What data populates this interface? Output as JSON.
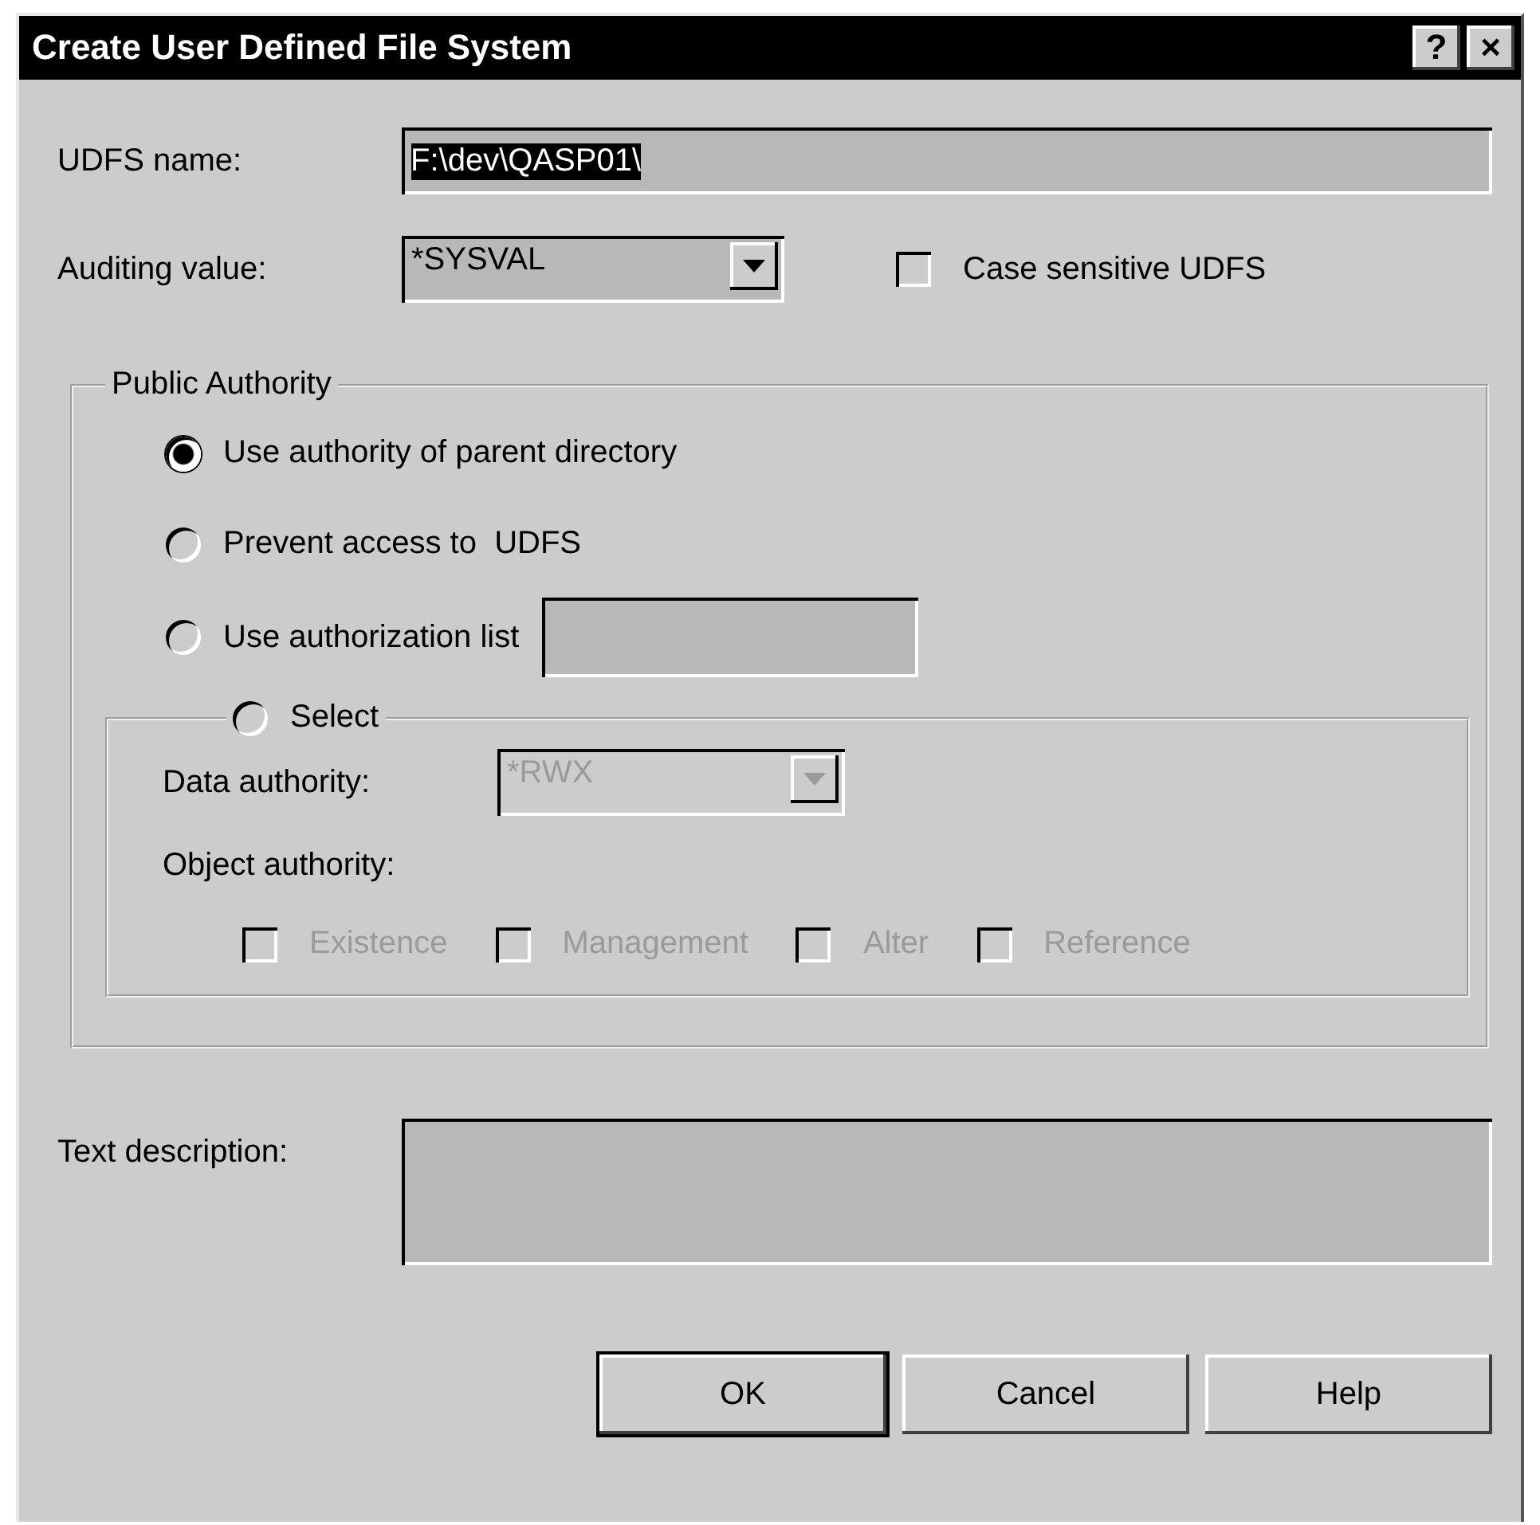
{
  "window": {
    "title": "Create User Defined File System",
    "title_buttons": [
      "?",
      "×"
    ]
  },
  "udfs_name": {
    "label": "UDFS name:",
    "value": "F:\\dev\\QASP01\\",
    "value_selected": true
  },
  "auditing": {
    "label": "Auditing value:",
    "value": "*SYSVAL",
    "disabled": false
  },
  "case_sensitive": {
    "label": "Case sensitive UDFS",
    "checked": false,
    "disabled": false
  },
  "public_authority": {
    "title": "Public Authority",
    "options": [
      {
        "label": "Use authority of parent directory",
        "selected": true,
        "kind": "plain"
      },
      {
        "label": "Prevent access to  UDFS",
        "selected": false,
        "kind": "plain"
      },
      {
        "label": "Use authorization list",
        "selected": false,
        "kind": "field"
      },
      {
        "label": "Select",
        "selected": false,
        "kind": "group"
      }
    ]
  },
  "select_group": {
    "data_authority": {
      "label": "Data authority:",
      "value": "*RWX",
      "disabled": true
    },
    "object_authority": {
      "label": "Object authority:",
      "options": [
        {
          "label": "Existence",
          "checked": false,
          "disabled": true
        },
        {
          "label": "Management",
          "checked": false,
          "disabled": true
        },
        {
          "label": "Alter",
          "checked": false,
          "disabled": true
        },
        {
          "label": "Reference",
          "checked": false,
          "disabled": true
        }
      ]
    }
  },
  "text_description": {
    "label": "Text description:"
  },
  "buttons": [
    {
      "label": "OK",
      "default": true
    },
    {
      "label": "Cancel",
      "default": false
    },
    {
      "label": "Help",
      "default": false
    }
  ]
}
